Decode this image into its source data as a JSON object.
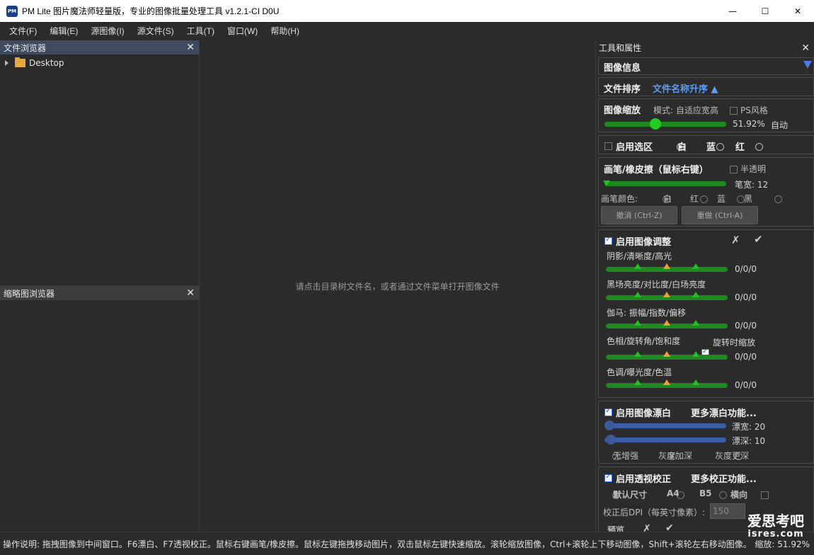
{
  "window": {
    "logo_text": "PM",
    "title": "PM Lite 图片魔法师轻量版，专业的图像批量处理工具 v1.2.1-CI D0U",
    "minimize": "—",
    "maximize": "☐",
    "close": "✕"
  },
  "menu": [
    "文件(F)",
    "编辑(E)",
    "源图像(I)",
    "源文件(S)",
    "工具(T)",
    "窗口(W)",
    "帮助(H)"
  ],
  "file_browser": {
    "title": "文件浏览器",
    "items": [
      {
        "label": "Desktop"
      }
    ]
  },
  "thumb_browser": {
    "title": "缩略图浏览器"
  },
  "center": {
    "hint": "请点击目录树文件名，或者通过文件菜单打开图像文件"
  },
  "tools": {
    "title": "工具和属性",
    "image_info": "图像信息",
    "sort": {
      "label": "文件排序",
      "value": "文件名称升序 ▲"
    },
    "zoom": {
      "label": "图像缩放",
      "mode": "模式: 自适应宽高",
      "ps_style": "PS风格",
      "percent": "51.92%",
      "auto": "自动",
      "value_fraction": 0.42
    },
    "selection": {
      "label": "启用选区",
      "options": [
        "白",
        "蓝",
        "红"
      ],
      "selected": 0
    },
    "brush": {
      "label": "画笔/橡皮擦（鼠标右键）",
      "semi": "半透明",
      "width_label": "笔宽: 12",
      "color_label": "画笔颜色:",
      "colors": [
        "白",
        "红",
        "蓝",
        "黑"
      ],
      "undo": "撤消 (Ctrl-Z)",
      "redo": "重做 (Ctrl-A)"
    },
    "adjust": {
      "label": "启用图像调整",
      "cancel": "✗",
      "ok": "✔",
      "rows": [
        {
          "label": "阴影/清晰度/高光",
          "value": "0/0/0"
        },
        {
          "label": "黑场亮度/对比度/白场亮度",
          "value": "0/0/0"
        },
        {
          "label": "伽马: 振幅/指数/偏移",
          "value": "0/0/0"
        },
        {
          "label": "色相/旋转角/饱和度",
          "value": "0/0/0"
        },
        {
          "label": "色调/曝光度/色温",
          "value": "0/0/0"
        }
      ],
      "rotate_zoom": "旋转时缩放"
    },
    "whiten": {
      "label": "启用图像漂白",
      "more": "更多漂白功能...",
      "width": "漂宽: 20",
      "depth": "漂深: 10",
      "modes": [
        "无增强",
        "灰度加深",
        "灰度更深"
      ],
      "selected": 1
    },
    "perspective": {
      "label": "启用透视校正",
      "more": "更多校正功能...",
      "sizes": [
        "默认尺寸",
        "A4",
        "B5"
      ],
      "landscape": "横向",
      "dpi_label": "校正后DPI（每英寸像素）:",
      "dpi_value": "150",
      "preview": "预览",
      "cancel": "✗",
      "ok": "✔"
    }
  },
  "status": {
    "text": "操作说明: 拖拽图像到中间窗口。F6漂白、F7透视校正。鼠标右键画笔/橡皮擦。鼠标左键拖拽移动图片，双击鼠标左键快速缩放。滚轮缩放图像，Ctrl+滚轮上下移动图像，Shift+滚轮左右移动图像。",
    "zoom": "缩放: 51.92%"
  },
  "watermark": {
    "line1": "爱思考吧",
    "line2": "isres.com"
  }
}
